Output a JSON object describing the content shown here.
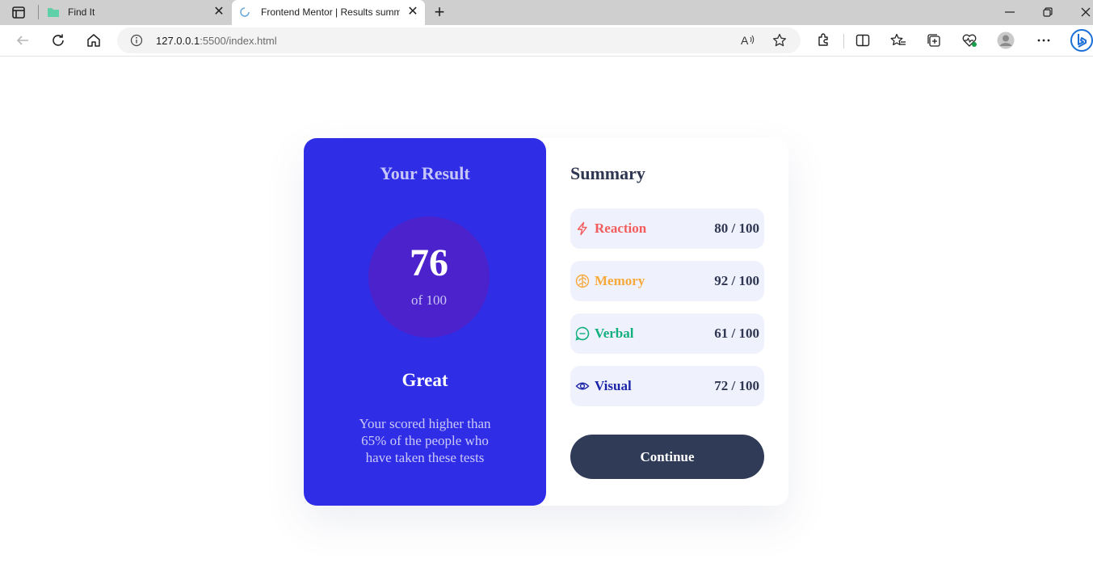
{
  "browser": {
    "tabs": [
      {
        "title": "Find It",
        "active": false
      },
      {
        "title": "Frontend Mentor | Results summary component",
        "active": true
      }
    ],
    "address_bar": {
      "host": "127.0.0.1",
      "path": ":5500/index.html"
    }
  },
  "result": {
    "heading": "Your Result",
    "score": "76",
    "score_of": "of 100",
    "rating": "Great",
    "description": "Your scored higher than 65% of the people who have taken these tests"
  },
  "summary": {
    "heading": "Summary",
    "items": [
      {
        "label": "Reaction",
        "score": "80",
        "max": " / 100",
        "color": "#f25c5c",
        "bg": "#fff2f2",
        "icon": "lightning-icon"
      },
      {
        "label": "Memory",
        "score": "92",
        "max": " / 100",
        "color": "#f7a93b",
        "bg": "#fff9ef",
        "icon": "brain-icon"
      },
      {
        "label": "Verbal",
        "score": "61",
        "max": " / 100",
        "color": "#12b07d",
        "bg": "#effbf6",
        "icon": "chat-bubble-icon"
      },
      {
        "label": "Visual",
        "score": "72",
        "max": " / 100",
        "color": "#1e26a8",
        "bg": "#eff0fc",
        "icon": "eye-icon"
      }
    ],
    "continue_label": "Continue"
  },
  "colors": {
    "result_panel": "#2f2de6",
    "score_circle": "#4b22cc",
    "button": "#303b57"
  }
}
